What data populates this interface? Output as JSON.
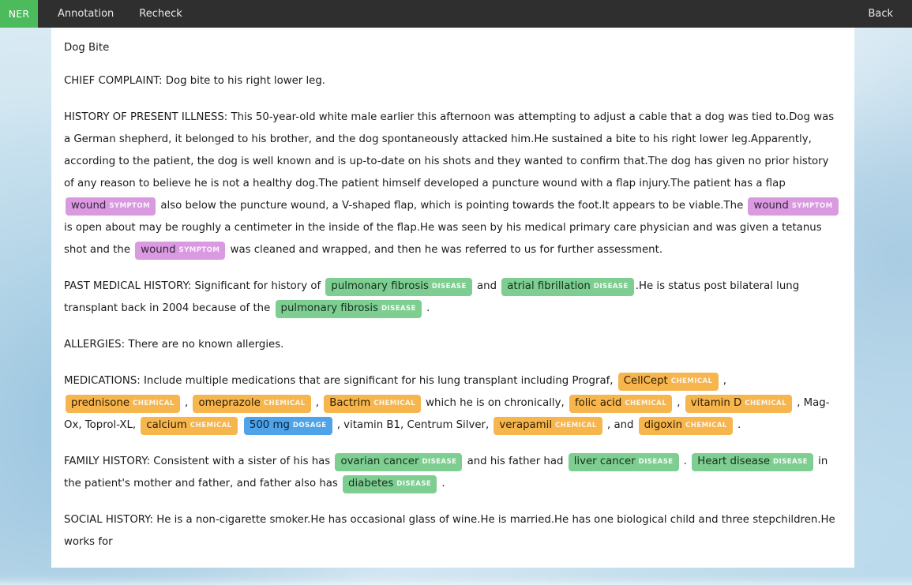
{
  "navbar": {
    "brand": "NER",
    "items": [
      {
        "label": "Annotation",
        "name": "annotation"
      },
      {
        "label": "Recheck",
        "name": "recheck"
      }
    ],
    "back": "Back"
  },
  "colors": {
    "brand_green": "#4cbb5c",
    "navbar_bg": "#2f2f2f",
    "symptom": "#d99ae0",
    "disease": "#7ece92",
    "chemical": "#f6b54d",
    "dosage": "#4fa3e8",
    "card_bg": "#ffffff"
  },
  "entity_labels": {
    "symptom": "SYMPTOM",
    "disease": "DISEASE",
    "chemical": "CHEMICAL",
    "dosage": "DOSAGE"
  },
  "document": {
    "title": "Dog Bite",
    "chief_complaint": "CHIEF COMPLAINT: Dog bite to his right lower leg.",
    "hpi": {
      "t1": "HISTORY OF PRESENT ILLNESS: This 50-year-old white male earlier this afternoon was attempting to adjust a cable that a dog was tied to.Dog was a German shepherd, it belonged to his brother, and the dog spontaneously attacked him.He sustained a bite to his right lower leg.Apparently, according to the patient, the dog is well known and is up-to-date on his shots and they wanted to confirm that.The dog has given no prior history of any reason to believe he is not a healthy dog.The patient himself developed a puncture wound with a flap injury.The patient has a flap ",
      "e1": "wound",
      "t2": " also below the puncture wound, a V-shaped flap, which is pointing towards the foot.It appears to be viable.The ",
      "e2": "wound",
      "t3": " is open about may be roughly a centimeter in the inside of the flap.He was seen by his medical primary care physician and was given a tetanus shot and the ",
      "e3": "wound",
      "t4": " was cleaned and wrapped, and then he was referred to us for further assessment."
    },
    "pmh": {
      "t1": "PAST MEDICAL HISTORY: Significant for history of ",
      "e1": "pulmonary fibrosis",
      "t2": " and ",
      "e2": "atrial fibrillation",
      "t3": ".He is status post bilateral lung transplant back in 2004 because of the ",
      "e3": "pulmonary fibrosis",
      "t4": " ."
    },
    "allergies": "ALLERGIES: There are no known allergies.",
    "medications": {
      "t1": "MEDICATIONS: Include multiple medications that are significant for his lung transplant including Prograf, ",
      "e1": "CellCept",
      "t2": " , ",
      "e2": "prednisone",
      "t3": " , ",
      "e3": "omeprazole",
      "t4": " , ",
      "e4": "Bactrim",
      "t5": " which he is on chronically, ",
      "e5": "folic acid",
      "t6": " , ",
      "e6": "vitamin D",
      "t7": " , Mag-Ox, Toprol-XL, ",
      "e7": "calcium",
      "t8": " ",
      "e8": "500 mg",
      "t9": " , vitamin B1, Centrum Silver, ",
      "e9": "verapamil",
      "t10": " , and ",
      "e10": "digoxin",
      "t11": " ."
    },
    "family_history": {
      "t1": "FAMILY HISTORY: Consistent with a sister of his has ",
      "e1": "ovarian cancer",
      "t2": " and his father had ",
      "e2": "liver cancer",
      "t3": " . ",
      "e3": "Heart disease",
      "t4": " in the patient's mother and father, and father also has ",
      "e4": "diabetes",
      "t5": " ."
    },
    "social_history": "SOCIAL HISTORY: He is a non-cigarette smoker.He has occasional glass of wine.He is married.He has one biological child and three stepchildren.He works for"
  }
}
